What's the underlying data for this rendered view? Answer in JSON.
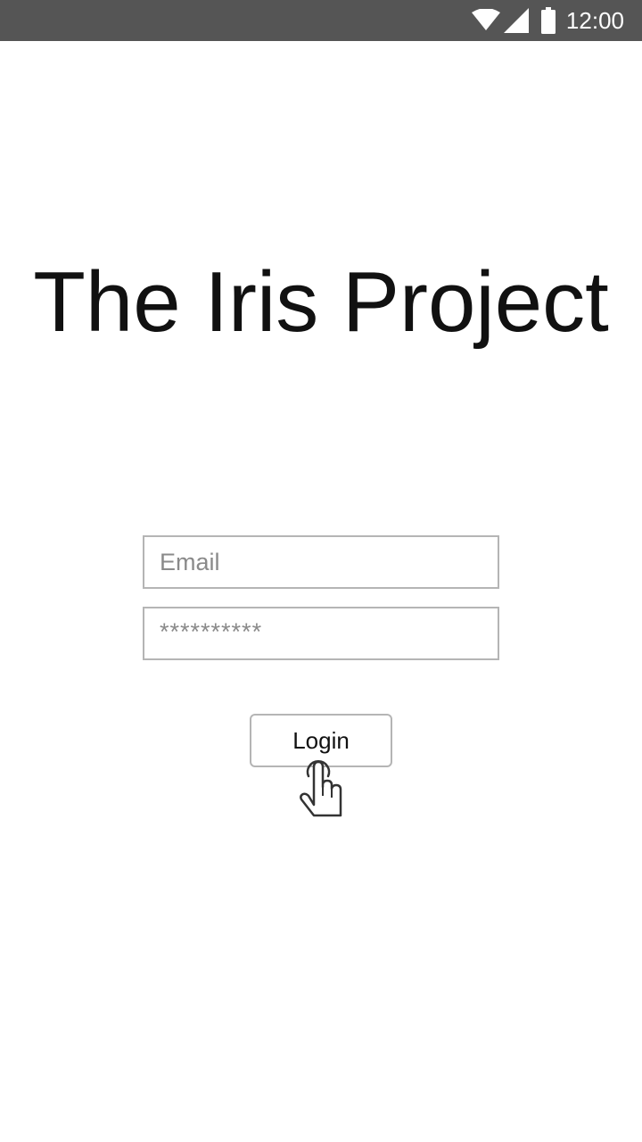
{
  "status_bar": {
    "time": "12:00",
    "icons": [
      "wifi-icon",
      "cellular-signal-icon",
      "battery-icon"
    ]
  },
  "login_screen": {
    "title": "The Iris Project",
    "email_placeholder": "Email",
    "password_masked": "**********",
    "login_label": "Login",
    "cursor_icon": "tap-hand-icon"
  },
  "colors": {
    "status_bar_bg": "#555555",
    "background": "#ffffff",
    "field_border": "#b5b5b5",
    "placeholder_text": "#8a8a8a",
    "title_text": "#111111"
  }
}
